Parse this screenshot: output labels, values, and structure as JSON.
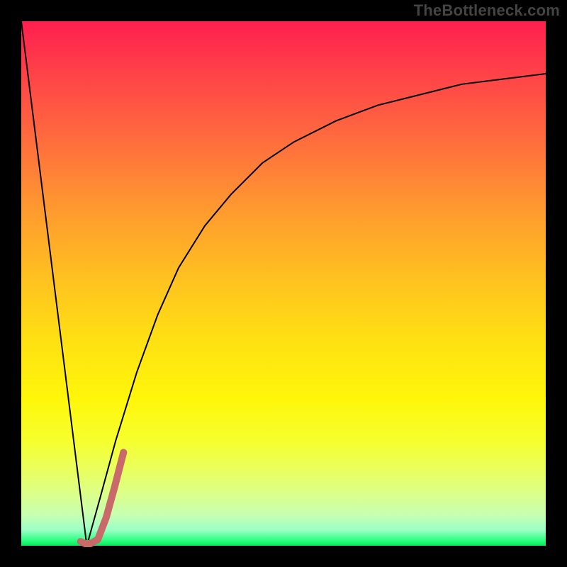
{
  "watermark": "TheBottleneck.com",
  "chart_data": {
    "type": "line",
    "title": "",
    "xlabel": "",
    "ylabel": "",
    "xlim": [
      0,
      100
    ],
    "ylim": [
      0,
      100
    ],
    "grid": false,
    "legend": false,
    "series": [
      {
        "name": "left-descent",
        "color": "#000000",
        "width": 2,
        "x": [
          0,
          12.5
        ],
        "values": [
          100,
          0
        ]
      },
      {
        "name": "right-rise-curve",
        "color": "#000000",
        "width": 2,
        "x": [
          12.5,
          15,
          18,
          22,
          26,
          30,
          35,
          40,
          46,
          52,
          60,
          68,
          76,
          84,
          92,
          100
        ],
        "values": [
          0,
          9,
          20,
          33,
          44,
          53,
          61,
          67,
          73,
          77,
          81,
          84,
          86,
          88,
          89,
          90
        ]
      },
      {
        "name": "marker-j-stroke",
        "color": "#c96a6a",
        "width": 10,
        "linecap": "round",
        "x": [
          11.3,
          12.2,
          13.2,
          14.6,
          16.2,
          17.8,
          19.5
        ],
        "values": [
          0.8,
          0.4,
          0.4,
          1.2,
          5.4,
          11.2,
          17.8
        ]
      }
    ],
    "background_gradient": {
      "direction": "top-to-bottom",
      "stops": [
        {
          "pos": 0.0,
          "color": "#ff1f4f"
        },
        {
          "pos": 0.36,
          "color": "#ff9a2f"
        },
        {
          "pos": 0.62,
          "color": "#ffe312"
        },
        {
          "pos": 0.86,
          "color": "#e8ff62"
        },
        {
          "pos": 0.99,
          "color": "#2bff7e"
        },
        {
          "pos": 1.0,
          "color": "#06e85a"
        }
      ]
    }
  }
}
